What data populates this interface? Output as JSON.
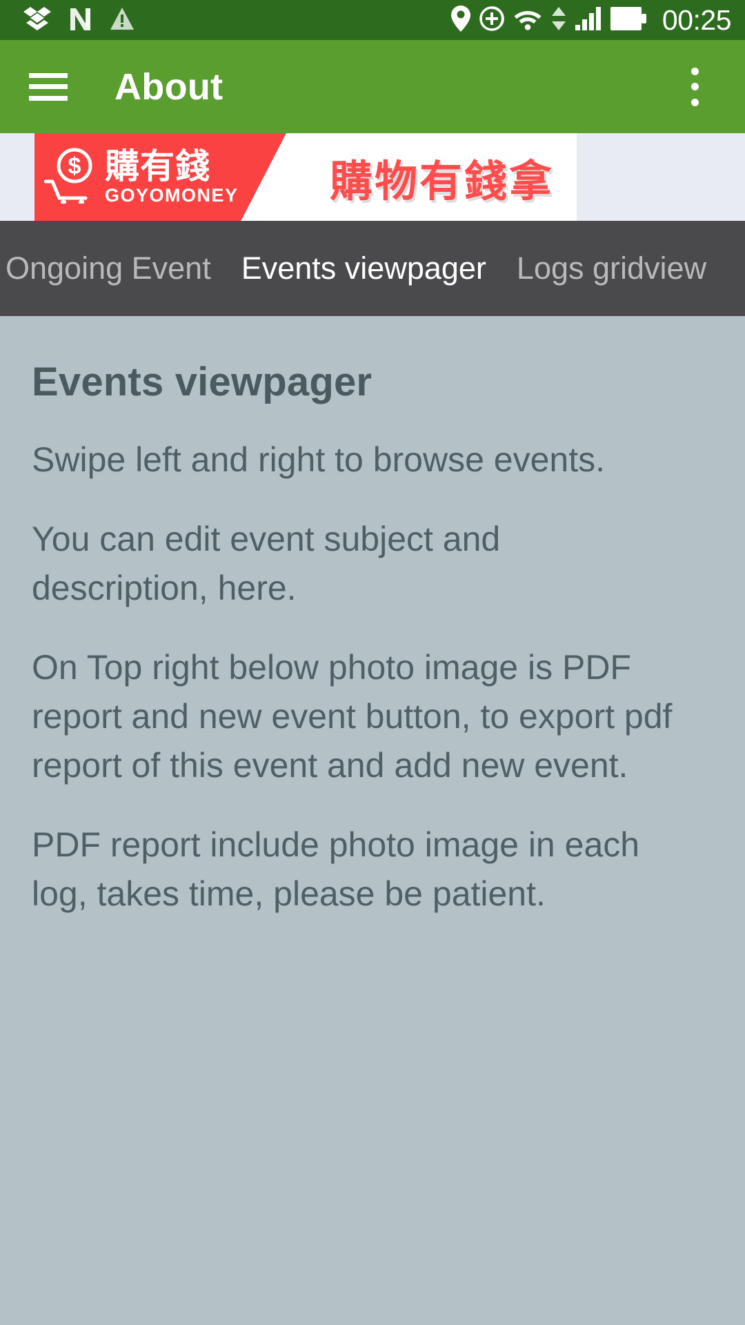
{
  "status_bar": {
    "background_color": "#2d6b1f",
    "clock": "00:25",
    "left_icons": [
      {
        "name": "dropbox-icon",
        "label": "Dropbox"
      },
      {
        "name": "n-app-icon",
        "label": "N"
      },
      {
        "name": "warning-triangle-icon",
        "label": "Warning"
      }
    ],
    "right_icons": [
      {
        "name": "location-pin-icon",
        "label": "Location"
      },
      {
        "name": "sync-add-icon",
        "label": "Sync"
      },
      {
        "name": "wifi-icon",
        "label": "Wi-Fi"
      },
      {
        "name": "data-transfer-arrows-icon",
        "label": "Data transfer"
      },
      {
        "name": "cellular-signal-icon",
        "label": "Signal"
      },
      {
        "name": "battery-full-icon",
        "label": "Battery"
      }
    ]
  },
  "app_bar": {
    "background_color": "#5a9e2f",
    "title": "About",
    "menu_icon": "hamburger-menu-icon",
    "overflow_icon": "overflow-menu-icon"
  },
  "ad_banner": {
    "background_color": "#e8eaf4",
    "brand_panel_color": "#fa4242",
    "brand_name_cn": "購有錢",
    "brand_name_en": "GOYOMONEY",
    "slogan": "購物有錢拿",
    "slogan_color": "#ff4d4d",
    "cart_icon": "shopping-cart-icon",
    "dollar_icon": "dollar-sign-icon"
  },
  "tab_bar": {
    "background_color": "#4a4a4d",
    "active_index": 1,
    "tabs": [
      {
        "label": "Ongoing Event"
      },
      {
        "label": "Events viewpager"
      },
      {
        "label": "Logs gridview"
      }
    ]
  },
  "content": {
    "background_color": "#b4c2c8",
    "heading": "Events viewpager",
    "text_color": "#4f5f64",
    "paragraphs": [
      "Swipe left and right to browse events.",
      "You can edit event subject and description, here.",
      "On Top right below photo image is PDF report and new event button, to export pdf report of this event and add new event.",
      "PDF report include photo image in each log, takes time, please be patient."
    ]
  }
}
